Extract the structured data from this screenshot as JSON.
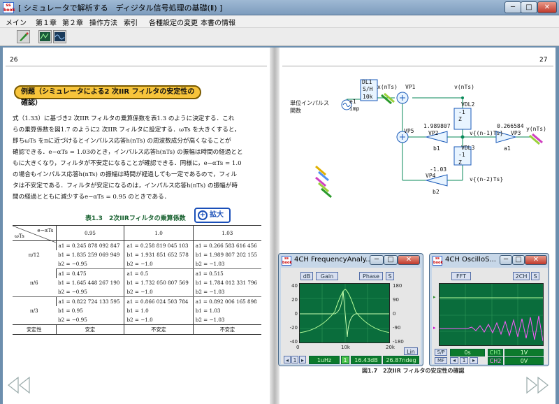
{
  "window": {
    "title": "[ シミュレータで解析する　ディジタル信号処理の基礎(Ⅱ) ]",
    "app_icon_text": "ss book"
  },
  "menu": [
    "メイン",
    "第１章",
    "第２章",
    "操作方法",
    "索引",
    "各種設定の変更",
    "本書の情報"
  ],
  "left_page": {
    "page_number": "26",
    "heading": "例題（シミュレータによる2 次IIR フィルタの安定性の確認）",
    "paragraph": [
      "式（1.33）に基づき2 次IIR フィルタの乗算係数を表1.3 のように決定する．これ",
      "らの乗算係数を図1.7 のように2 次IIR フィルタに設定する．ωTs を大きくすると，",
      "即ちωTs をπに近づけるとインパルス応答h(nTs) の周波数成分が高くなることが",
      "確認できる．e−αTs = 1.03のとき，インパルス応答h(nTs) の振幅は時間の経過とと",
      "もに大きくなり，フィルタが不安定になることが確認できる．同様に，e−αTs = 1.0",
      "の場合もインパルス応答h(nTs) の振幅は時間が経過しても一定であるので，フィル",
      "タは不安定である．フィルタが安定になるのは，インパルス応答h(nTs) の振幅が時",
      "間の経過とともに減少するe−αTs = 0.95 のときである．"
    ],
    "table_caption": "表1.3　2次IIRフィルタの乗算係数",
    "zoom_button": "拡大",
    "table": {
      "corner_top": "e−αTs",
      "corner_bottom": "ωTs",
      "columns": [
        "0.95",
        "1.0",
        "1.03"
      ],
      "groups": [
        {
          "label": "π/12",
          "rows": [
            [
              "a1 = 0.245 878 092 847",
              "a1 = 0.258 819 045 103",
              "a1 = 0.266 583 616 456"
            ],
            [
              "b1 = 1.835 259 069 949",
              "b1 = 1.931 851 652 578",
              "b1 = 1.989 807 202 155"
            ],
            [
              "b2 = −0.95",
              "b2 = −1.0",
              "b2 = −1.03"
            ]
          ]
        },
        {
          "label": "π/6",
          "rows": [
            [
              "a1 = 0.475",
              "a1 = 0.5",
              "a1 = 0.515"
            ],
            [
              "b1 = 1.645 448 267 190",
              "b1 = 1.732 050 807 569",
              "b1 = 1.784 012 331 796"
            ],
            [
              "b2 = −0.95",
              "b2 = −1.0",
              "b2 = −1.03"
            ]
          ]
        },
        {
          "label": "π/3",
          "rows": [
            [
              "a1 = 0.822 724 133 595",
              "a1 = 0.866 024 503 784",
              "a1 = 0.892 006 165 898"
            ],
            [
              "b1 = 0.95",
              "b1 = 1.0",
              "b1 = 1.03"
            ],
            [
              "b2 = −0.95",
              "b2 = −1.0",
              "b2 = −1.03"
            ]
          ]
        }
      ],
      "stability_label": "安定性",
      "stability": [
        "安定",
        "不安定",
        "不安定"
      ]
    }
  },
  "right_page": {
    "page_number": "27",
    "figure_caption": "図1.7　2次IIR フィルタの安定性の確認",
    "diagram": {
      "input_label": "単位インパルス\n関数",
      "source_name": "e1",
      "source_sub": "imp",
      "dl1": "DL1",
      "sh_text": "S/H",
      "sh_value": "10k",
      "x_label": "x(nTs)",
      "vp1": "VP1",
      "v_label": "v(nTs)",
      "vdl2": "VDL2",
      "z_inv": "Z",
      "minus_one": "-1",
      "vp2": "VP2",
      "vp2_val": "1.989807",
      "b1": "b1",
      "vp5": "VP5",
      "vdl3": "VDL3",
      "vn1": "v{(n-1)Ts}",
      "vp3": "VP3",
      "vp3_val": "0.266584",
      "a1": "a1",
      "y_label": "y(nTs)",
      "vp4": "VP4",
      "vp4_val": "-1.03",
      "b2": "b2",
      "vn2": "v{(n-2)Ts}"
    }
  },
  "freq_window": {
    "title": "4CH FrequencyAnaly...",
    "db_btn": "dB",
    "gain_btn": "Gain",
    "phase_btn": "Phase",
    "s_btn": "S",
    "y_left": [
      "40",
      "20",
      "0",
      "-20",
      "-40"
    ],
    "y_right": [
      "180",
      "90",
      "0",
      "-90",
      "-180"
    ],
    "x_ticks": [
      "0",
      "10k",
      "20k"
    ],
    "lin_btn": "Lin",
    "freq_value": "1uHz",
    "ch": "1",
    "gain_value": "16.43dB",
    "phase_value": "26.87ndeg"
  },
  "scope_window": {
    "title": "4CH OscilloS...",
    "fft_btn": "FFT",
    "ch_btn": "2CH",
    "s_btn": "S",
    "sp_btn": "S/P",
    "mf_btn": "MF",
    "time_value": "0s",
    "ch1_label": "CH1",
    "ch1_value": "1V",
    "ch2_label": "CH2",
    "ch2_value": "0V"
  }
}
